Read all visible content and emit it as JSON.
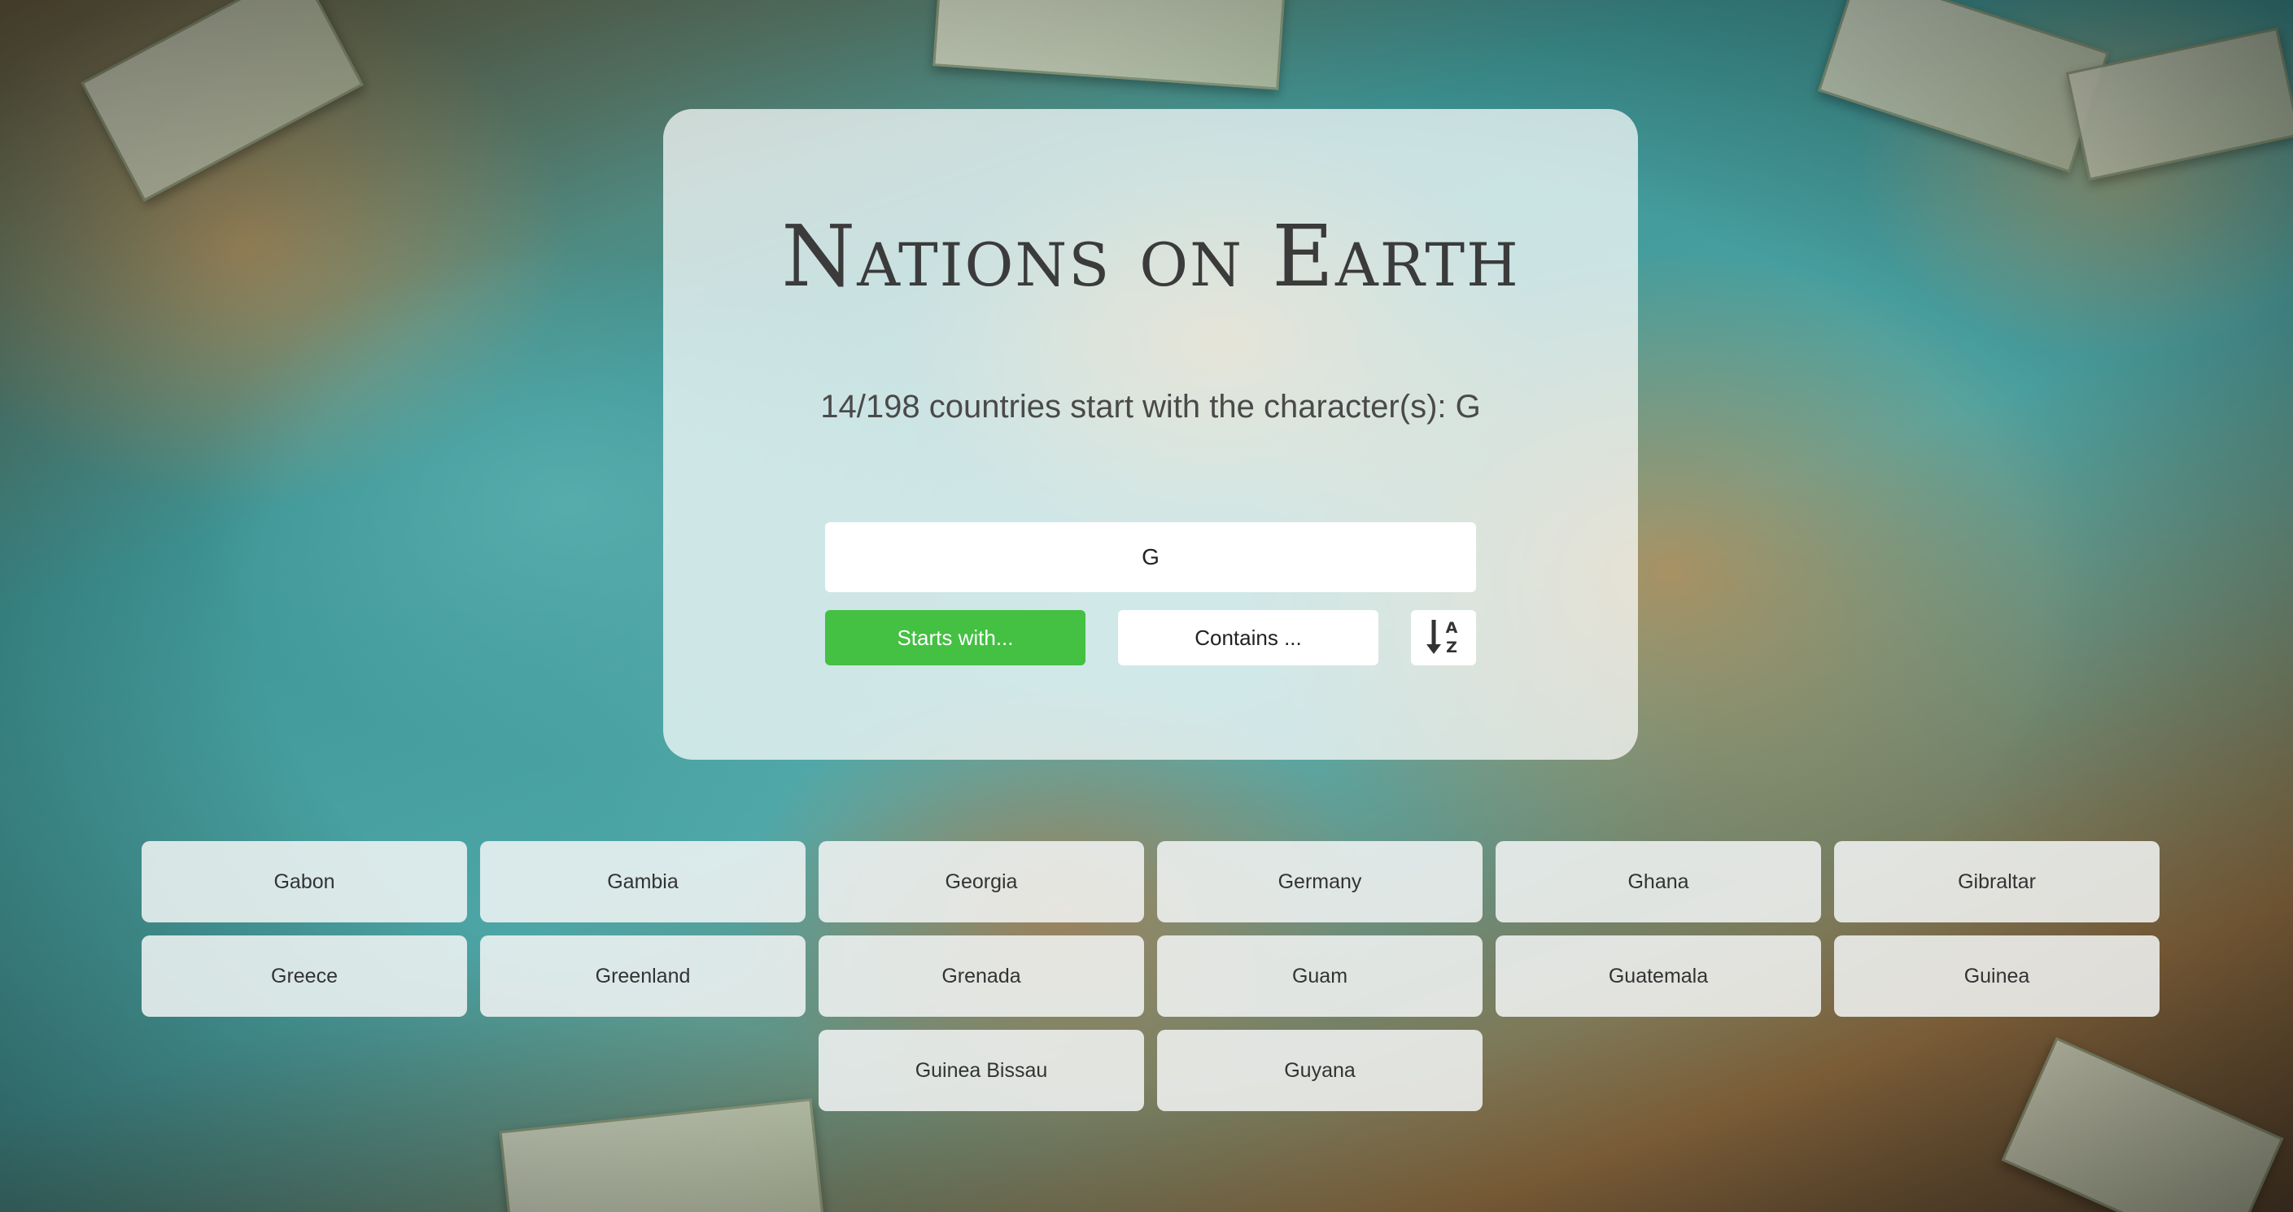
{
  "page": {
    "title": "Nations on Earth",
    "result_text": "14/198 countries start with the character(s): G"
  },
  "search": {
    "value": "G"
  },
  "controls": {
    "starts_with_label": "Starts with...",
    "contains_label": "Contains ...",
    "sort_icon": "sort-alpha-down-icon",
    "active_mode": "starts_with",
    "active_color": "#44c043"
  },
  "countries": [
    "Gabon",
    "Gambia",
    "Georgia",
    "Germany",
    "Ghana",
    "Gibraltar",
    "Greece",
    "Greenland",
    "Grenada",
    "Guam",
    "Guatemala",
    "Guinea",
    "Guinea Bissau",
    "Guyana"
  ]
}
